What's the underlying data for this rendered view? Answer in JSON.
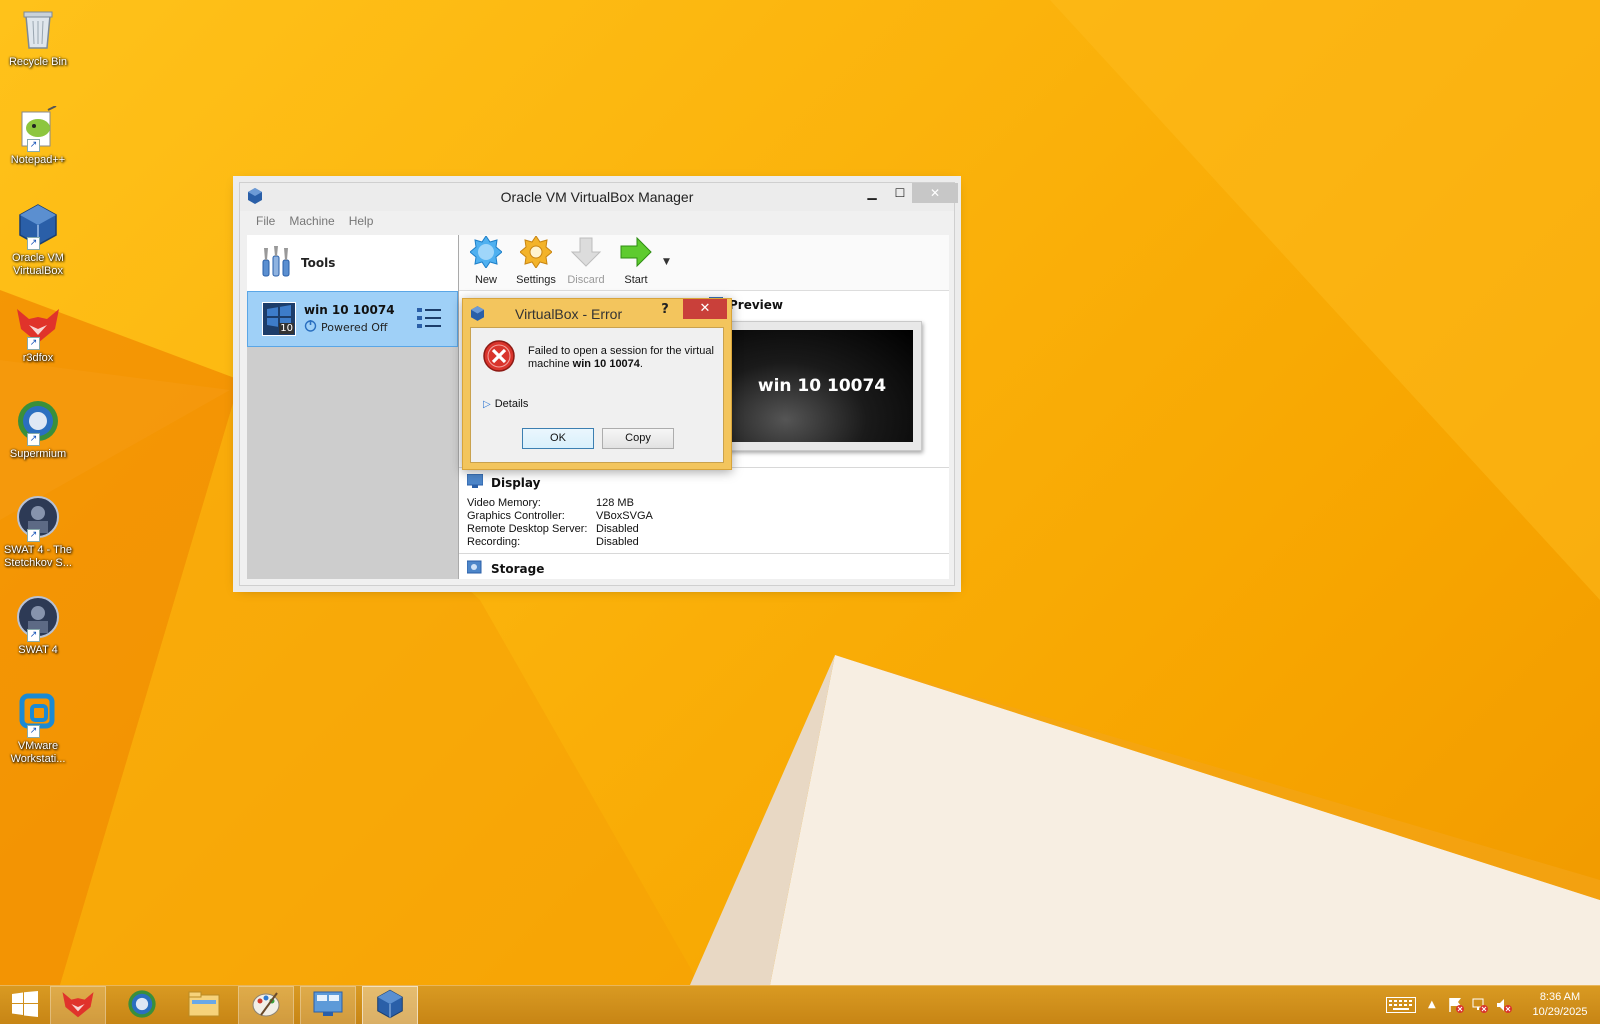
{
  "desktop": {
    "icons": [
      {
        "label": "Recycle Bin"
      },
      {
        "label": "Notepad++"
      },
      {
        "label": "Oracle VM\nVirtualBox"
      },
      {
        "label": "r3dfox"
      },
      {
        "label": "Supermium"
      },
      {
        "label": "SWAT 4 - The\nStetchkov S..."
      },
      {
        "label": "SWAT 4"
      },
      {
        "label": "VMware\nWorkstati..."
      }
    ]
  },
  "vbox": {
    "title": "Oracle VM VirtualBox Manager",
    "menu": [
      "File",
      "Machine",
      "Help"
    ],
    "tools_label": "Tools",
    "vm": {
      "name": "win 10 10074",
      "state": "Powered Off",
      "badge": "10"
    },
    "toolbar": {
      "new": "New",
      "settings": "Settings",
      "discard": "Discard",
      "start": "Start"
    },
    "preview": {
      "heading": "Preview",
      "screen_text": "win 10 10074"
    },
    "display": {
      "heading": "Display",
      "rows": [
        {
          "k": "Video Memory:",
          "v": "128 MB"
        },
        {
          "k": "Graphics Controller:",
          "v": "VBoxSVGA"
        },
        {
          "k": "Remote Desktop Server:",
          "v": "Disabled"
        },
        {
          "k": "Recording:",
          "v": "Disabled"
        }
      ]
    },
    "storage": {
      "heading": "Storage"
    }
  },
  "error_dialog": {
    "title": "VirtualBox - Error",
    "help": "?",
    "close": "✕",
    "message_prefix": "Failed to open a session for the virtual machine ",
    "message_vm": "win 10 10074",
    "message_suffix": ".",
    "details": "Details",
    "ok": "OK",
    "copy": "Copy"
  },
  "taskbar": {
    "time": "8:36 AM",
    "date": "10/29/2025"
  },
  "colors": {
    "accent_error": "#c9403a",
    "desktop": "#f6a400",
    "selection": "#9fd0f7"
  }
}
